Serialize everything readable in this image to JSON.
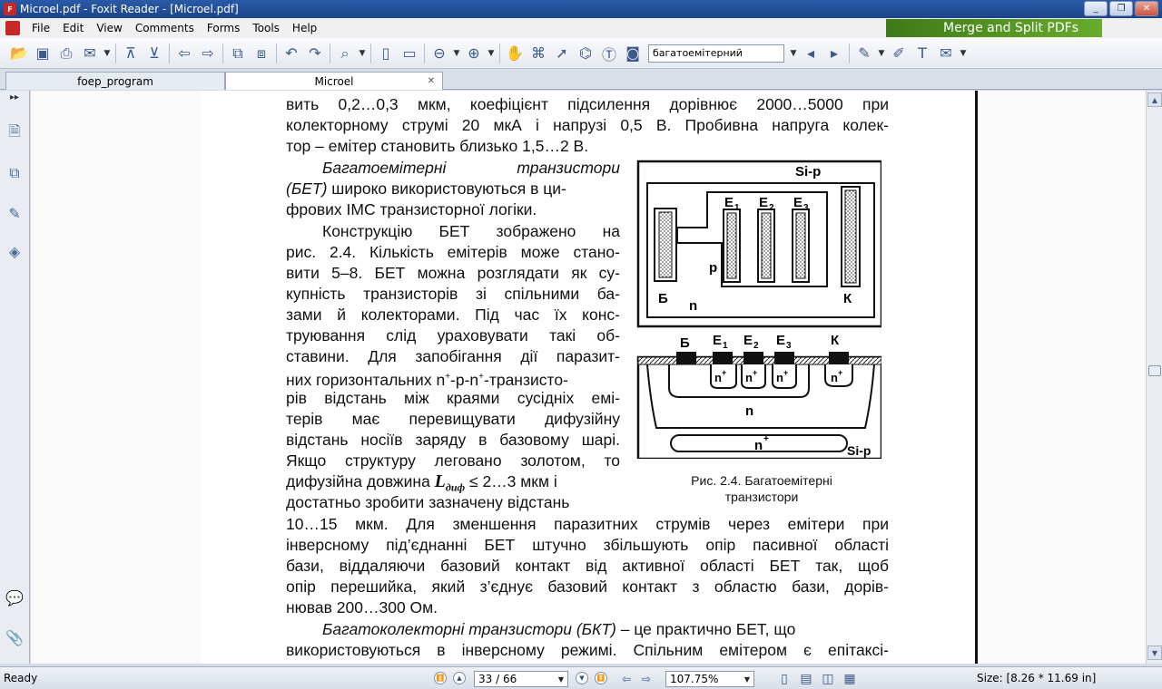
{
  "window": {
    "title": "Microel.pdf - Foxit Reader - [Microel.pdf]",
    "controls": [
      "_",
      "❐",
      "✕"
    ]
  },
  "menu": {
    "items": [
      "File",
      "Edit",
      "View",
      "Comments",
      "Forms",
      "Tools",
      "Help"
    ],
    "promo": "Merge and Split PDFs"
  },
  "toolbar": {
    "search_value": "багатоемітерний"
  },
  "tabs": [
    {
      "label": "foep_program"
    },
    {
      "label": "Microel",
      "close": "✕"
    }
  ],
  "document": {
    "lines_top": [
      "вить 0,2…0,3 мкм, коефіцієнт підсилення дорівнює 2000…5000 при",
      "колекторному струмі 20 мкА і напрузі 0,5 В. Пробивна напруга колек-",
      "тор – емітер становить близько 1,5…2 В."
    ],
    "para2_line1_italic": "Багатоемітерні транзистори",
    "para2_line2_italic": "(БЕТ)",
    "para2_line2_rest": " широко використовуються в ци-",
    "para2_line3": "фрових ІМС транзисторної логіки.",
    "left_column": [
      "Конструкцію БЕТ зображено на",
      "рис. 2.4. Кількість емітерів може стано-",
      "вити 5–8. БЕТ можна розглядати як су-",
      "купність транзисторів зі спільними ба-",
      "зами й колекторами. Під час їх конс-",
      "труювання слід ураховувати такі об-",
      "ставини. Для запобігання дії паразит-"
    ],
    "npn_line_a": "них горизонтальних n",
    "npn_sup1": "+",
    "npn_line_b": "-p-n",
    "npn_sup2": "+",
    "npn_line_c": "-транзисто-",
    "left_column2": [
      "рів відстань між краями сусідніх емі-",
      "терів має перевищувати дифузійну ",
      "відстань носіїв заряду в базовому шарі.",
      "Якщо структуру леговано золотом, то"
    ],
    "ldif_before": "дифузійна довжина ",
    "ldif_symbol": "L",
    "ldif_sub": "диф",
    "ldif_after": " ≤ 2…3 мкм і",
    "left_last": "достатньо зробити зазначену відстань",
    "lines_bottom": [
      "10…15 мкм. Для зменшення паразитних струмів через емітери при",
      "інверсному під’єднанні БЕТ штучно збільшують опір пасивної області",
      "бази, віддаляючи базовий контакт від активної області БЕТ так, щоб",
      "опір перешийка, який з’єднує базовий контакт з областю бази, дорів-",
      "нював 200…300 Ом."
    ],
    "last_italic": "Багатоколекторні транзистори (БКТ)",
    "last_rest": " – це практично БЕТ, що",
    "very_last": "використовуються в інверсному режимі. Спільним емітером є епітаксі-"
  },
  "figure": {
    "top": {
      "si_p": "Si-p",
      "e1": "E",
      "e1_sub": "1",
      "e2": "E",
      "e2_sub": "2",
      "e3": "E",
      "e3_sub": "3",
      "p": "p",
      "b": "Б",
      "n": "n",
      "k": "К"
    },
    "bottom": {
      "b": "Б",
      "e1": "E",
      "e1_sub": "1",
      "e2": "E",
      "e2_sub": "2",
      "e3": "E",
      "e3_sub": "3",
      "k": "К",
      "nplus": "n",
      "plus": "+",
      "n": "n",
      "si_p": "Si-p"
    },
    "caption_line1": "Рис. 2.4. Багатоемітерні",
    "caption_line2": "транзистори"
  },
  "status": {
    "ready": "Ready",
    "page": "33 / 66",
    "zoom": "107.75%",
    "size": "Size: [8.26 * 11.69 in]"
  }
}
